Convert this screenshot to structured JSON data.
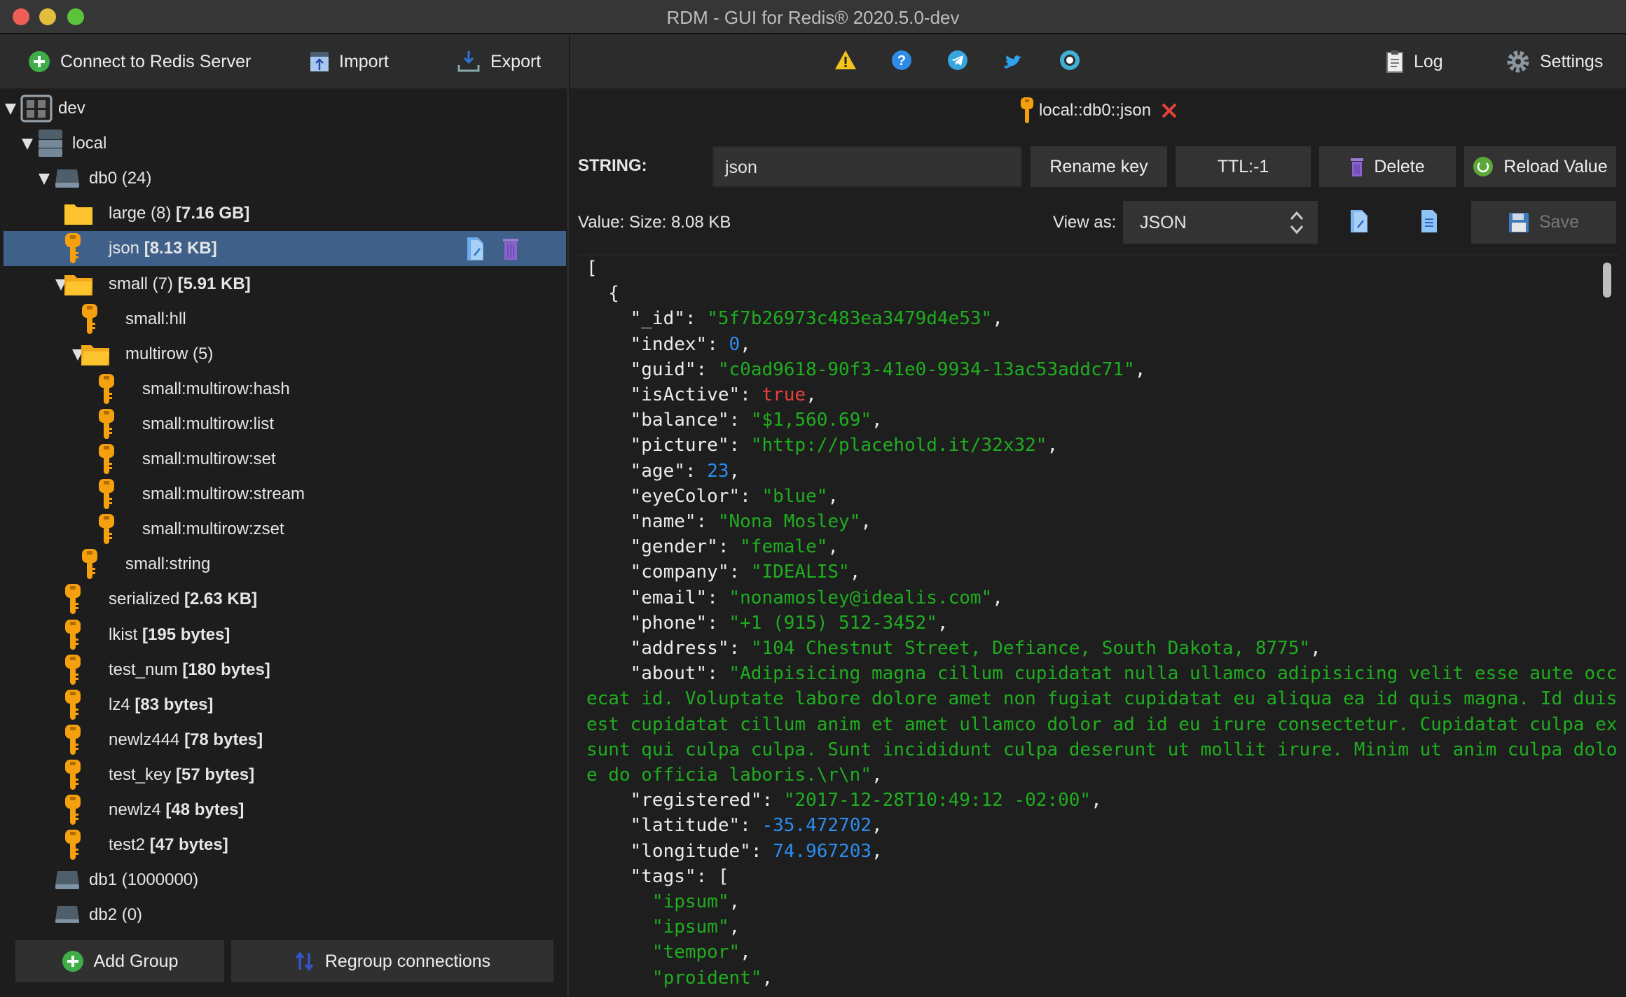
{
  "window": {
    "title": "RDM - GUI for Redis® 2020.5.0-dev"
  },
  "toolbar": {
    "connect_label": "Connect to Redis Server",
    "import_label": "Import",
    "export_label": "Export",
    "center_icons": [
      "warning-icon",
      "help-icon",
      "telegram-icon",
      "twitter-icon",
      "github-icon"
    ],
    "log_label": "Log",
    "settings_label": "Settings"
  },
  "tree": [
    {
      "depth": 0,
      "icon": "server-group",
      "label": "dev",
      "extra": "",
      "arrow": true
    },
    {
      "depth": 1,
      "icon": "server",
      "label": "local",
      "extra": "",
      "arrow": true
    },
    {
      "depth": 2,
      "icon": "db",
      "label": "db0  (24)",
      "extra": "",
      "arrow": true
    },
    {
      "depth": 3,
      "icon": "folder",
      "label": "large (8) ",
      "extra": "[7.16 GB]",
      "arrow": false
    },
    {
      "depth": 3,
      "icon": "key",
      "label": "json ",
      "extra": "[8.13 KB]",
      "arrow": false,
      "selected": true
    },
    {
      "depth": 3,
      "icon": "folder-open",
      "label": "small (7) ",
      "extra": "[5.91 KB]",
      "arrow": true
    },
    {
      "depth": 4,
      "icon": "key",
      "label": "small:hll",
      "extra": "",
      "arrow": false
    },
    {
      "depth": 4,
      "icon": "folder-open",
      "label": "multirow (5)",
      "extra": "",
      "arrow": true
    },
    {
      "depth": 5,
      "icon": "key",
      "label": "small:multirow:hash",
      "extra": "",
      "arrow": false
    },
    {
      "depth": 5,
      "icon": "key",
      "label": "small:multirow:list",
      "extra": "",
      "arrow": false
    },
    {
      "depth": 5,
      "icon": "key",
      "label": "small:multirow:set",
      "extra": "",
      "arrow": false
    },
    {
      "depth": 5,
      "icon": "key",
      "label": "small:multirow:stream",
      "extra": "",
      "arrow": false
    },
    {
      "depth": 5,
      "icon": "key",
      "label": "small:multirow:zset",
      "extra": "",
      "arrow": false
    },
    {
      "depth": 4,
      "icon": "key",
      "label": "small:string",
      "extra": "",
      "arrow": false
    },
    {
      "depth": 3,
      "icon": "key",
      "label": "serialized ",
      "extra": "[2.63 KB]",
      "arrow": false
    },
    {
      "depth": 3,
      "icon": "key",
      "label": "lkist ",
      "extra": "[195 bytes]",
      "arrow": false
    },
    {
      "depth": 3,
      "icon": "key",
      "label": "test_num ",
      "extra": "[180 bytes]",
      "arrow": false
    },
    {
      "depth": 3,
      "icon": "key",
      "label": "lz4 ",
      "extra": "[83 bytes]",
      "arrow": false
    },
    {
      "depth": 3,
      "icon": "key",
      "label": "newlz444 ",
      "extra": "[78 bytes]",
      "arrow": false
    },
    {
      "depth": 3,
      "icon": "key",
      "label": "test_key ",
      "extra": "[57 bytes]",
      "arrow": false
    },
    {
      "depth": 3,
      "icon": "key",
      "label": "newlz4 ",
      "extra": "[48 bytes]",
      "arrow": false
    },
    {
      "depth": 3,
      "icon": "key",
      "label": "test2 ",
      "extra": "[47 bytes]",
      "arrow": false
    },
    {
      "depth": 2,
      "icon": "db",
      "label": "db1  (1000000)",
      "extra": "",
      "arrow": false
    },
    {
      "depth": 2,
      "icon": "db",
      "label": "db2  (0)",
      "extra": "",
      "arrow": false
    }
  ],
  "sidebar_buttons": {
    "add_group": "Add Group",
    "regroup": "Regroup connections"
  },
  "tab": {
    "title": "local::db0::json"
  },
  "key": {
    "type_label": "STRING:",
    "name_value": "json",
    "rename": "Rename key",
    "ttl": "TTL:-1",
    "delete": "Delete",
    "reload": "Reload Value"
  },
  "value": {
    "size_label": "Value:  Size: 8.08 KB",
    "view_as_label": "View as:",
    "view_as": "JSON",
    "save": "Save"
  },
  "colors": {
    "string": "#1fae1f",
    "number": "#2b8ef0",
    "boolean": "#e8403a",
    "selection": "#3f6189",
    "key_icon": "#f5a00f"
  },
  "editor": {
    "lines": [
      [
        [
          "p",
          "["
        ]
      ],
      [
        [
          "p",
          "  {"
        ]
      ],
      [
        [
          "k",
          "    \"_id\""
        ],
        [
          "p",
          ": "
        ],
        [
          "s",
          "\"5f7b26973c483ea3479d4e53\""
        ],
        [
          "p",
          ","
        ]
      ],
      [
        [
          "k",
          "    \"index\""
        ],
        [
          "p",
          ": "
        ],
        [
          "n",
          "0"
        ],
        [
          "p",
          ","
        ]
      ],
      [
        [
          "k",
          "    \"guid\""
        ],
        [
          "p",
          ": "
        ],
        [
          "s",
          "\"c0ad9618-90f3-41e0-9934-13ac53addc71\""
        ],
        [
          "p",
          ","
        ]
      ],
      [
        [
          "k",
          "    \"isActive\""
        ],
        [
          "p",
          ": "
        ],
        [
          "b",
          "true"
        ],
        [
          "p",
          ","
        ]
      ],
      [
        [
          "k",
          "    \"balance\""
        ],
        [
          "p",
          ": "
        ],
        [
          "s",
          "\"$1,560.69\""
        ],
        [
          "p",
          ","
        ]
      ],
      [
        [
          "k",
          "    \"picture\""
        ],
        [
          "p",
          ": "
        ],
        [
          "s",
          "\"http://placehold.it/32x32\""
        ],
        [
          "p",
          ","
        ]
      ],
      [
        [
          "k",
          "    \"age\""
        ],
        [
          "p",
          ": "
        ],
        [
          "n",
          "23"
        ],
        [
          "p",
          ","
        ]
      ],
      [
        [
          "k",
          "    \"eyeColor\""
        ],
        [
          "p",
          ": "
        ],
        [
          "s",
          "\"blue\""
        ],
        [
          "p",
          ","
        ]
      ],
      [
        [
          "k",
          "    \"name\""
        ],
        [
          "p",
          ": "
        ],
        [
          "s",
          "\"Nona Mosley\""
        ],
        [
          "p",
          ","
        ]
      ],
      [
        [
          "k",
          "    \"gender\""
        ],
        [
          "p",
          ": "
        ],
        [
          "s",
          "\"female\""
        ],
        [
          "p",
          ","
        ]
      ],
      [
        [
          "k",
          "    \"company\""
        ],
        [
          "p",
          ": "
        ],
        [
          "s",
          "\"IDEALIS\""
        ],
        [
          "p",
          ","
        ]
      ],
      [
        [
          "k",
          "    \"email\""
        ],
        [
          "p",
          ": "
        ],
        [
          "s",
          "\"nonamosley@idealis.com\""
        ],
        [
          "p",
          ","
        ]
      ],
      [
        [
          "k",
          "    \"phone\""
        ],
        [
          "p",
          ": "
        ],
        [
          "s",
          "\"+1 (915) 512-3452\""
        ],
        [
          "p",
          ","
        ]
      ],
      [
        [
          "k",
          "    \"address\""
        ],
        [
          "p",
          ": "
        ],
        [
          "s",
          "\"104 Chestnut Street, Defiance, South Dakota, 8775\""
        ],
        [
          "p",
          ","
        ]
      ],
      [
        [
          "k",
          "    \"about\""
        ],
        [
          "p",
          ": "
        ],
        [
          "s",
          "\"Adipisicing magna cillum cupidatat nulla ullamco adipisicing velit esse aute occa"
        ]
      ],
      [
        [
          "s",
          "ecat id. Voluptate labore dolore amet non fugiat cupidatat eu aliqua ea id quis magna. Id duis "
        ]
      ],
      [
        [
          "s",
          "est cupidatat cillum anim et amet ullamco dolor ad id eu irure consectetur. Cupidatat culpa ex "
        ]
      ],
      [
        [
          "s",
          "sunt qui culpa culpa. Sunt incididunt culpa deserunt ut mollit irure. Minim ut anim culpa dolor"
        ]
      ],
      [
        [
          "s",
          "e do officia laboris.\\r\\n\""
        ],
        [
          "p",
          ","
        ]
      ],
      [
        [
          "k",
          "    \"registered\""
        ],
        [
          "p",
          ": "
        ],
        [
          "s",
          "\"2017-12-28T10:49:12 -02:00\""
        ],
        [
          "p",
          ","
        ]
      ],
      [
        [
          "k",
          "    \"latitude\""
        ],
        [
          "p",
          ": "
        ],
        [
          "n",
          "-35.472702"
        ],
        [
          "p",
          ","
        ]
      ],
      [
        [
          "k",
          "    \"longitude\""
        ],
        [
          "p",
          ": "
        ],
        [
          "n",
          "74.967203"
        ],
        [
          "p",
          ","
        ]
      ],
      [
        [
          "k",
          "    \"tags\""
        ],
        [
          "p",
          ": ["
        ]
      ],
      [
        [
          "s",
          "      \"ipsum\""
        ],
        [
          "p",
          ","
        ]
      ],
      [
        [
          "s",
          "      \"ipsum\""
        ],
        [
          "p",
          ","
        ]
      ],
      [
        [
          "s",
          "      \"tempor\""
        ],
        [
          "p",
          ","
        ]
      ],
      [
        [
          "s",
          "      \"proident\""
        ],
        [
          "p",
          ","
        ]
      ]
    ]
  }
}
